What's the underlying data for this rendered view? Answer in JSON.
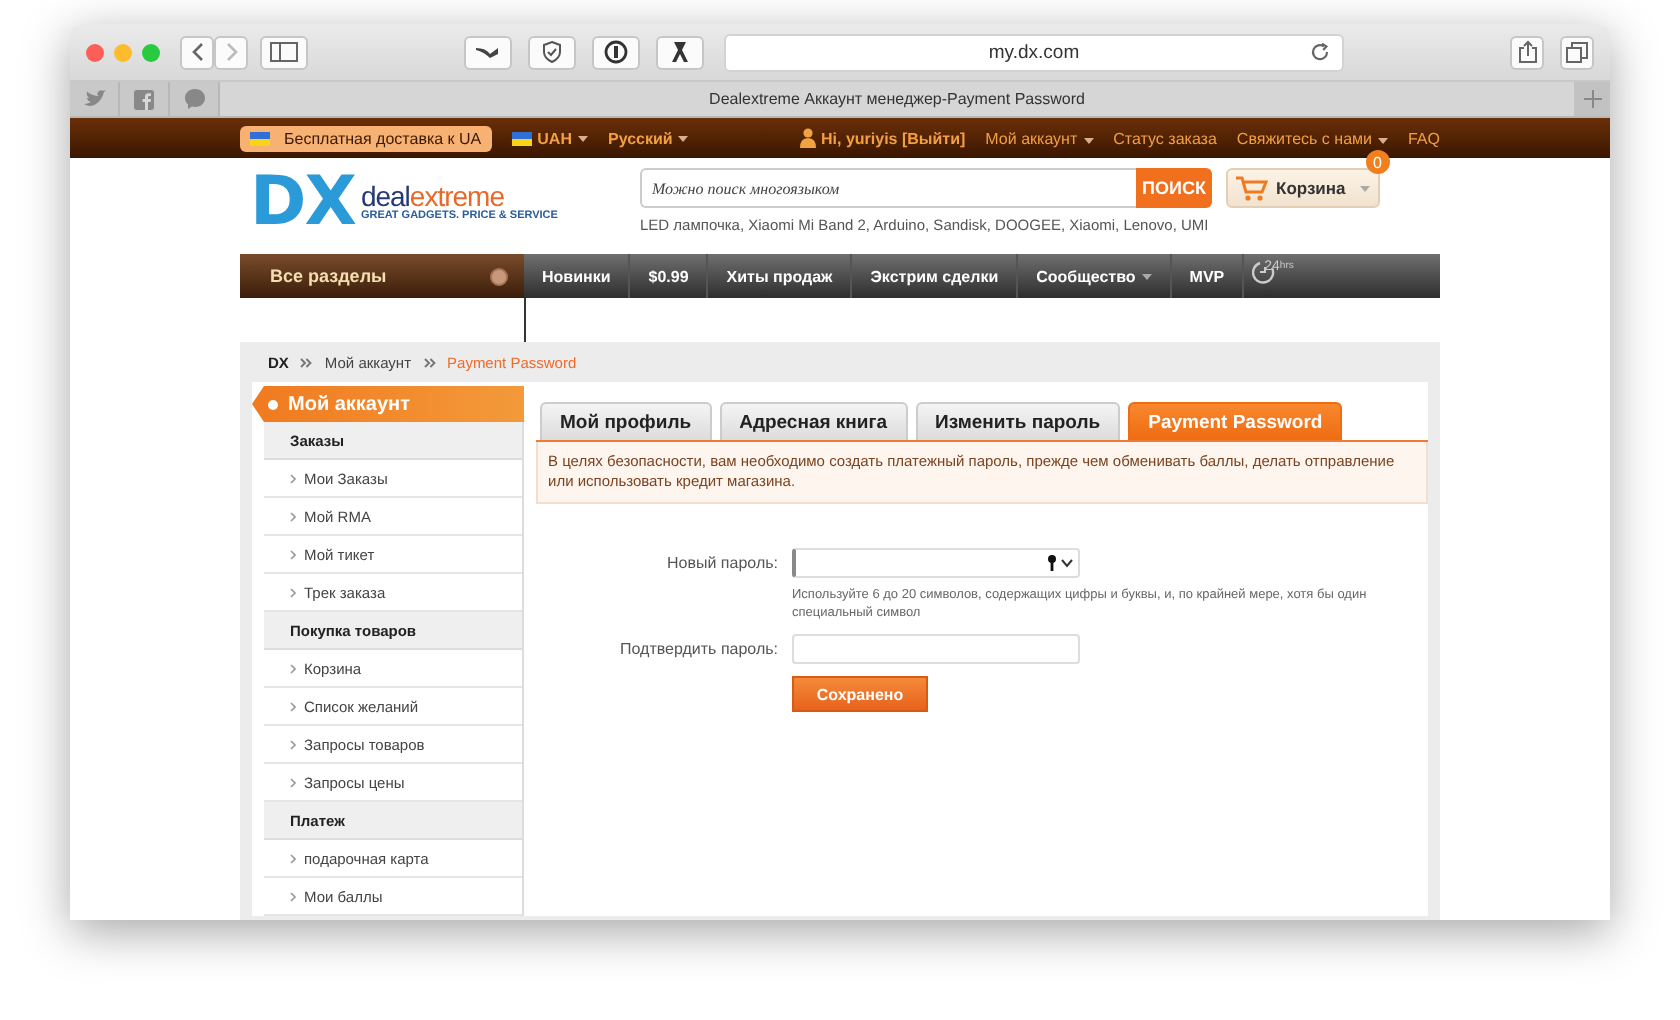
{
  "browser": {
    "url": "my.dx.com",
    "tab_title": "Dealextreme Аккаунт менеджер-Payment Password"
  },
  "topbar": {
    "promo": "Бесплатная доставка к UA",
    "selectors": [
      {
        "label": "UAH",
        "flag": true,
        "dropdown": true
      },
      {
        "label": "Русский",
        "flag": false,
        "dropdown": true
      }
    ],
    "greeting": "Hi, yuriyis [Выйти]",
    "links": [
      {
        "label": "Мой аккаунт",
        "dropdown": true
      },
      {
        "label": "Статус заказа",
        "dropdown": false
      },
      {
        "label": "Свяжитесь с нами",
        "dropdown": true
      },
      {
        "label": "FAQ",
        "dropdown": false
      }
    ]
  },
  "header": {
    "logo_mark": "DX",
    "logo_deal": "deal",
    "logo_extreme": "extreme",
    "tagline": "GREAT GADGETS. PRICE & SERVICE",
    "search": {
      "placeholder": "Можно поиск многоязыком",
      "button": "ПОИСК"
    },
    "suggestions": "LED лампочка,  Xiaomi Mi Band 2,  Arduino,  Sandisk,  DOOGEE,  Xiaomi,  Lenovo,  UMI",
    "cart": {
      "label": "Корзина",
      "count": "0"
    }
  },
  "nav": {
    "all_sections": "Все разделы",
    "items": [
      {
        "label": "Новинки",
        "dropdown": false
      },
      {
        "label": "$0.99",
        "dropdown": false
      },
      {
        "label": "Хиты продаж",
        "dropdown": false
      },
      {
        "label": "Экстрим сделки",
        "dropdown": false
      },
      {
        "label": "Сообщество",
        "dropdown": true
      },
      {
        "label": "MVP",
        "dropdown": false
      }
    ],
    "badge": "24",
    "badge_unit": "hrs"
  },
  "breadcrumb": [
    {
      "label": "DX",
      "current": false
    },
    {
      "label": "Мой аккаунт",
      "current": false
    },
    {
      "label": "Payment Password",
      "current": true
    }
  ],
  "sidebar": {
    "title": "Мой аккаунт",
    "sections": [
      {
        "heading": "Заказы",
        "items": [
          "Мои Заказы",
          "Мой RMA",
          "Мой тикет",
          "Трек заказа"
        ]
      },
      {
        "heading": "Покупка товаров",
        "items": [
          "Корзина",
          "Список желаний",
          "Запросы товаров",
          "Запросы цены"
        ]
      },
      {
        "heading": "Платеж",
        "items": [
          "подарочная карта",
          "Мои баллы"
        ]
      }
    ]
  },
  "tabs": [
    {
      "label": "Мой профиль",
      "selected": false
    },
    {
      "label": "Адресная книга",
      "selected": false
    },
    {
      "label": "Изменить пароль",
      "selected": false
    },
    {
      "label": "Payment Password",
      "selected": true
    }
  ],
  "notice": "В целях безопасности, вам необходимо создать платежный пароль, прежде чем обменивать баллы, делать отправление или использовать кредит  магазина.",
  "form": {
    "fields": [
      {
        "label": "Новый пароль:",
        "key_icon": true,
        "hint": "Используйте 6 до 20 символов, содержащих цифры и буквы, и, по крайней мере, хотя бы один специальный символ"
      },
      {
        "label": "Подтвердить пароль:",
        "key_icon": false
      }
    ],
    "submit": "Сохранено"
  }
}
